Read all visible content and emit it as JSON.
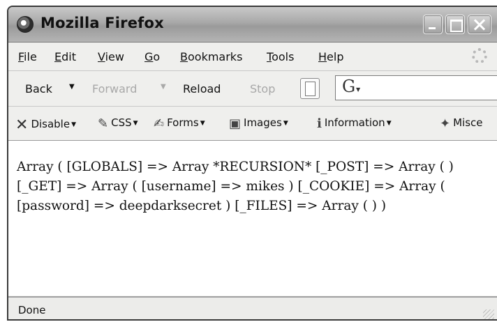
{
  "window": {
    "title": "Mozilla Firefox"
  },
  "menu": {
    "items": [
      {
        "label": "File",
        "access": "F",
        "rest": "ile"
      },
      {
        "label": "Edit",
        "access": "E",
        "rest": "dit"
      },
      {
        "label": "View",
        "access": "V",
        "rest": "iew"
      },
      {
        "label": "Go",
        "access": "G",
        "rest": "o"
      },
      {
        "label": "Bookmarks",
        "access": "B",
        "rest": "ookmarks"
      },
      {
        "label": "Tools",
        "access": "T",
        "rest": "ools"
      },
      {
        "label": "Help",
        "access": "H",
        "rest": "elp"
      }
    ]
  },
  "navigation": {
    "back": "Back",
    "forward": "Forward",
    "reload": "Reload",
    "stop": "Stop",
    "search_value": ""
  },
  "devtoolbar": {
    "items": [
      {
        "label": "Disable",
        "icon": "disable-x-icon"
      },
      {
        "label": "CSS",
        "icon": "css-icon"
      },
      {
        "label": "Forms",
        "icon": "forms-icon"
      },
      {
        "label": "Images",
        "icon": "images-icon"
      },
      {
        "label": "Information",
        "icon": "information-icon"
      },
      {
        "label": "Misce",
        "icon": "miscellaneous-icon"
      }
    ]
  },
  "content": {
    "text": "Array ( [GLOBALS] => Array *RECURSION* [_POST] => Array ( ) [_GET] => Array ( [username] => mikes ) [_COOKIE] => Array ( [password] => deepdarksecret ) [_FILES] => Array ( ) )"
  },
  "status": {
    "text": "Done"
  }
}
